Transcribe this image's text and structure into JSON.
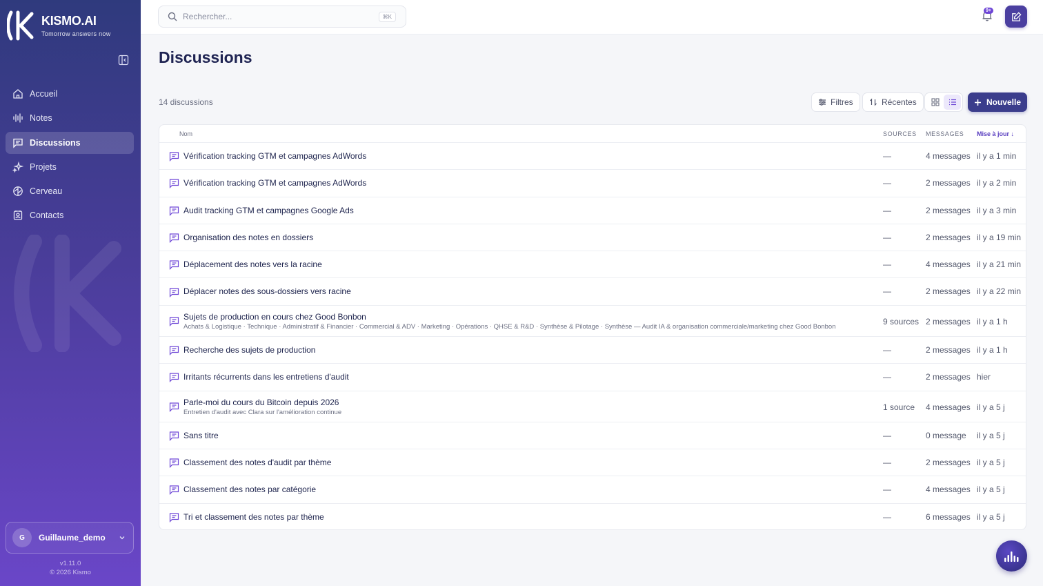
{
  "brand": {
    "name": "KISMO.AI",
    "tagline": "Tomorrow answers now"
  },
  "sidebar": {
    "items": [
      {
        "label": "Accueil",
        "icon": "home-icon"
      },
      {
        "label": "Notes",
        "icon": "waveform-icon"
      },
      {
        "label": "Discussions",
        "icon": "message-square-icon",
        "active": true
      },
      {
        "label": "Projets",
        "icon": "sparkles-icon"
      },
      {
        "label": "Cerveau",
        "icon": "brain-icon"
      },
      {
        "label": "Contacts",
        "icon": "contact-book-icon"
      }
    ],
    "user": {
      "initial": "G",
      "name": "Guillaume_demo"
    },
    "version": "v1.11.0",
    "copyright": "© 2026 Kismo"
  },
  "topbar": {
    "search_placeholder": "Rechercher...",
    "shortcut": "⌘K",
    "notification_badge": "9+"
  },
  "page": {
    "title": "Discussions",
    "count": "14 discussions",
    "filters_label": "Filtres",
    "sort_label": "Récentes",
    "new_label": "Nouvelle"
  },
  "table": {
    "headers": {
      "name": "Nom",
      "sources": "SOURCES",
      "messages": "MESSAGES",
      "updated": "Mise à jour ↓"
    },
    "rows": [
      {
        "title": "Vérification tracking GTM et campagnes AdWords",
        "subtitle": "",
        "sources": "—",
        "messages": "4 messages",
        "updated": "il y a 1 min"
      },
      {
        "title": "Vérification tracking GTM et campagnes AdWords",
        "subtitle": "",
        "sources": "—",
        "messages": "2 messages",
        "updated": "il y a 2 min"
      },
      {
        "title": "Audit tracking GTM et campagnes Google Ads",
        "subtitle": "",
        "sources": "—",
        "messages": "2 messages",
        "updated": "il y a 3 min"
      },
      {
        "title": "Organisation des notes en dossiers",
        "subtitle": "",
        "sources": "—",
        "messages": "2 messages",
        "updated": "il y a 19 min"
      },
      {
        "title": "Déplacement des notes vers la racine",
        "subtitle": "",
        "sources": "—",
        "messages": "4 messages",
        "updated": "il y a 21 min"
      },
      {
        "title": "Déplacer notes des sous-dossiers vers racine",
        "subtitle": "",
        "sources": "—",
        "messages": "2 messages",
        "updated": "il y a 22 min"
      },
      {
        "title": "Sujets de production en cours chez Good Bonbon",
        "subtitle": "Achats & Logistique · Technique · Administratif & Financier · Commercial & ADV · Marketing · Opérations · QHSE & R&D · Synthèse & Pilotage · Synthèse — Audit IA & organisation commerciale/marketing chez Good Bonbon",
        "sources": "9 sources",
        "messages": "2 messages",
        "updated": "il y a 1 h"
      },
      {
        "title": "Recherche des sujets de production",
        "subtitle": "",
        "sources": "—",
        "messages": "2 messages",
        "updated": "il y a 1 h"
      },
      {
        "title": "Irritants récurrents dans les entretiens d'audit",
        "subtitle": "",
        "sources": "—",
        "messages": "2 messages",
        "updated": "hier"
      },
      {
        "title": "Parle-moi du cours du Bitcoin depuis 2026",
        "subtitle": "Entretien d'audit avec Clara sur l'amélioration continue",
        "sources": "1 source",
        "messages": "4 messages",
        "updated": "il y a 5 j"
      },
      {
        "title": "Sans titre",
        "subtitle": "",
        "sources": "—",
        "messages": "0 message",
        "updated": "il y a 5 j"
      },
      {
        "title": "Classement des notes d'audit par thème",
        "subtitle": "",
        "sources": "—",
        "messages": "2 messages",
        "updated": "il y a 5 j"
      },
      {
        "title": "Classement des notes par catégorie",
        "subtitle": "",
        "sources": "—",
        "messages": "4 messages",
        "updated": "il y a 5 j"
      },
      {
        "title": "Tri et classement des notes par thème",
        "subtitle": "",
        "sources": "—",
        "messages": "6 messages",
        "updated": "il y a 5 j"
      }
    ]
  },
  "colors": {
    "accent": "#6d45d6",
    "primary_button": "#3b3d8c",
    "sidebar_top": "#2f3a7d",
    "sidebar_bottom": "#6a46c8"
  }
}
